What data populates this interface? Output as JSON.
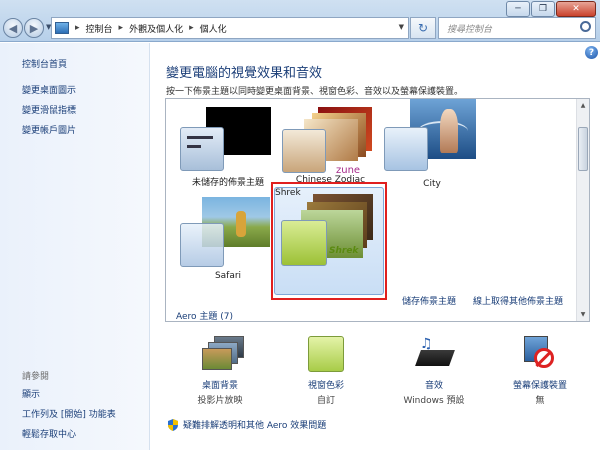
{
  "window": {
    "minimize": "─",
    "maximize": "❐",
    "close": "✕"
  },
  "address": {
    "crumbs": [
      "控制台",
      "外觀及個人化",
      "個人化"
    ],
    "separator": "▸",
    "search_placeholder": "搜尋控制台"
  },
  "sidebar": {
    "home": "控制台首頁",
    "links": [
      "變更桌面圖示",
      "變更滑鼠指標",
      "變更帳戶圖片"
    ],
    "see_also_title": "請參閱",
    "see_also": [
      "顯示",
      "工作列及 [開始] 功能表",
      "輕鬆存取中心"
    ]
  },
  "main": {
    "title": "變更電腦的視覺效果和音效",
    "description": "按一下佈景主題以同時變更桌面背景、視窗色彩、音效以及螢幕保護裝置。",
    "save_theme": "儲存佈景主題",
    "online_themes": "線上取得其他佈景主題",
    "aero_section": "Aero 主題 (7)"
  },
  "themes": [
    {
      "label": "未儲存的佈景主題"
    },
    {
      "label": "Chinese Zodiac"
    },
    {
      "label": "City"
    },
    {
      "label": "Safari"
    },
    {
      "label": "Shrek"
    }
  ],
  "zune_logo": "zune",
  "shrek_logo": "Shrek",
  "options": [
    {
      "name": "桌面背景",
      "value": "投影片放映"
    },
    {
      "name": "視窗色彩",
      "value": "自訂"
    },
    {
      "name": "音效",
      "value": "Windows 預設"
    },
    {
      "name": "螢幕保護裝置",
      "value": "無"
    }
  ],
  "troubleshoot": "疑難排解透明和其他 Aero 效果問題",
  "colors": {
    "link": "#1a3e78",
    "selection_border": "#e01f1f",
    "window_color": "#b4d85a"
  }
}
